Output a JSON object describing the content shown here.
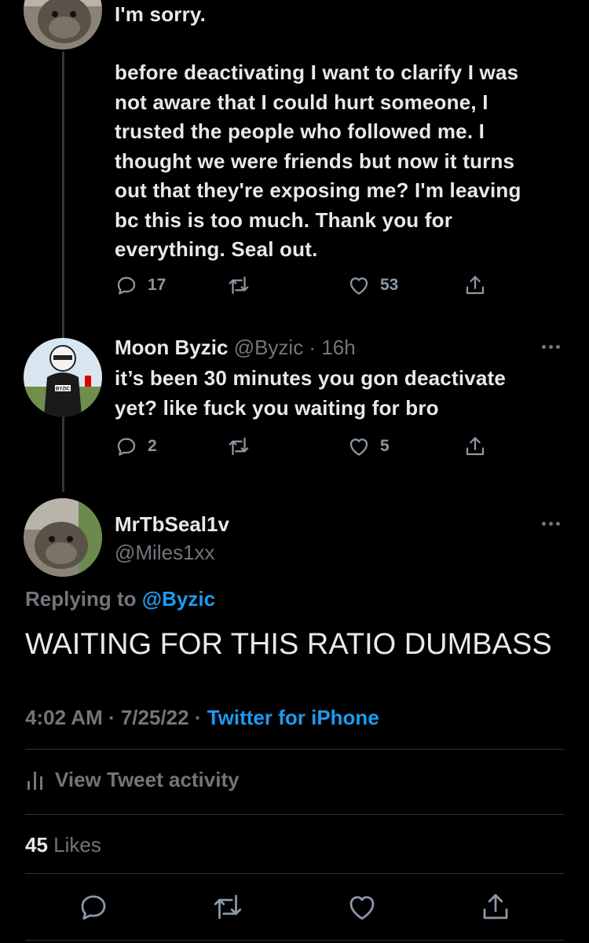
{
  "tweet1": {
    "first_line": "I'm sorry.",
    "body_lines": [
      "before deactivating I want to clarify I was",
      "not aware that I could hurt someone, I",
      "trusted the people who followed me. I",
      "thought we were friends but now it turns",
      "out that they're exposing me? I'm leaving",
      "bc this is too much. Thank you for",
      "everything. Seal out."
    ],
    "replies": "17",
    "likes": "53"
  },
  "tweet2": {
    "name": "Moon Byzic",
    "handle": "@Byzic",
    "separator": " · ",
    "time": "16h",
    "lines": [
      "it’s been 30 minutes you gon deactivate",
      "yet? like fuck you waiting for bro"
    ],
    "replies": "2",
    "likes": "5",
    "avatar_badge": "BYZIC"
  },
  "main": {
    "name": "MrTbSeal1v",
    "handle": "@Miles1xx",
    "replying_prefix": "Replying to ",
    "replying_to": "@Byzic",
    "text": "WAITING FOR THIS RATIO DUMBASS",
    "time": "4:02 AM",
    "date": "7/25/22",
    "dot": " · ",
    "source": "Twitter for iPhone",
    "activity_label": "View Tweet activity",
    "likes_count": "45",
    "likes_label": "Likes"
  },
  "icons": [
    "reply-icon",
    "retweet-icon",
    "like-icon",
    "share-icon",
    "more-icon",
    "analytics-icon"
  ],
  "colors": {
    "background": "#000000",
    "text": "#e7e9ea",
    "muted": "#71767b",
    "accent": "#1d9bf0"
  }
}
